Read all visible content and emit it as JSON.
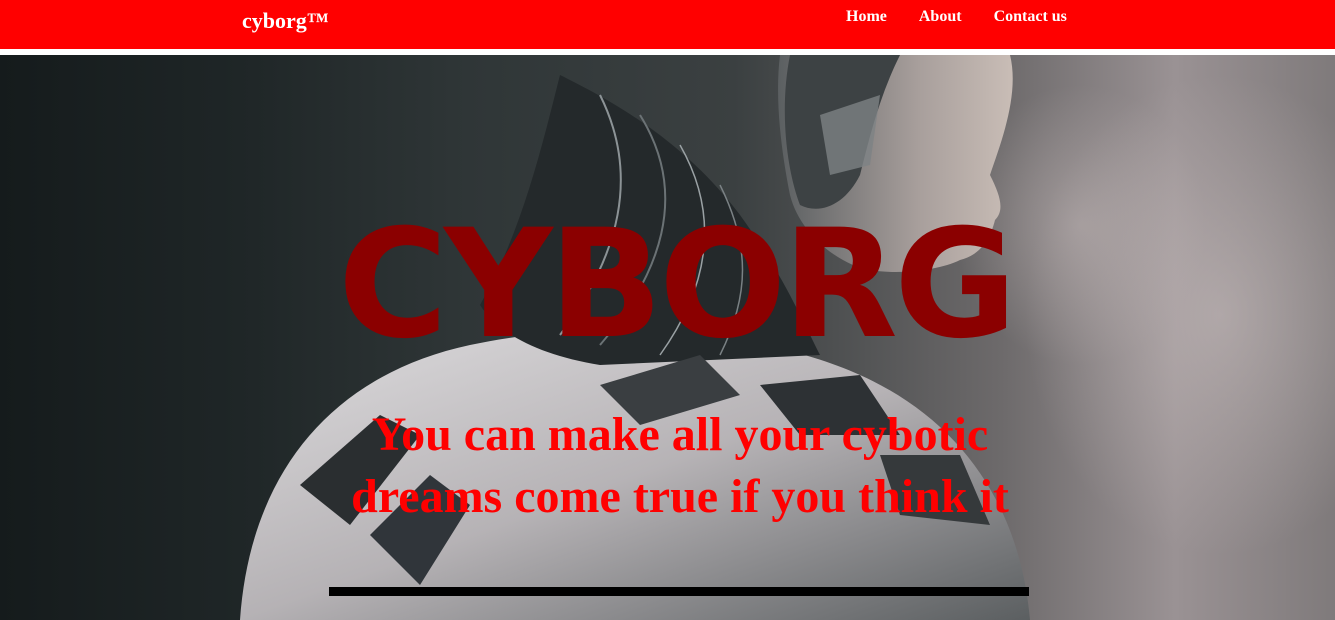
{
  "navbar": {
    "brand": "cyborg™",
    "links": [
      {
        "label": "Home"
      },
      {
        "label": "About"
      },
      {
        "label": "Contact us"
      }
    ],
    "color": "#ff0000"
  },
  "hero": {
    "title": "CYBORG",
    "tagline": "You can make all your cybotic dreams come true if you think it",
    "title_color": "#8b0000",
    "tagline_color": "#ff0000"
  }
}
